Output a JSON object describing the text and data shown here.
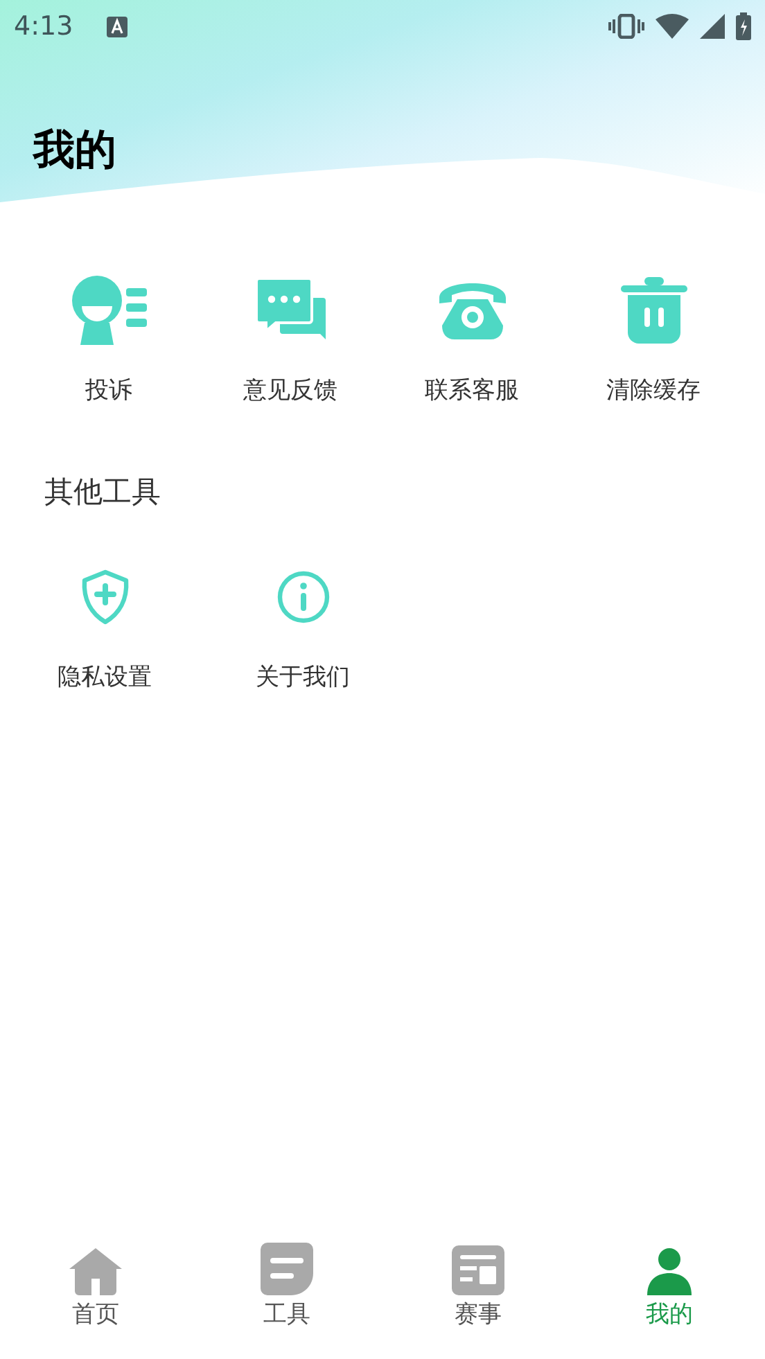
{
  "status_bar": {
    "time": "4:13"
  },
  "header": {
    "title": "我的"
  },
  "services": [
    {
      "kind": "complaint",
      "label": "投诉"
    },
    {
      "kind": "feedback",
      "label": "意见反馈"
    },
    {
      "kind": "phone",
      "label": "联系客服"
    },
    {
      "kind": "trash",
      "label": "清除缓存"
    }
  ],
  "other_tools": {
    "title": "其他工具",
    "items": [
      {
        "kind": "shield",
        "label": "隐私设置"
      },
      {
        "kind": "info",
        "label": "关于我们"
      }
    ]
  },
  "bottom_nav": [
    {
      "kind": "home",
      "label": "首页",
      "selected": false
    },
    {
      "kind": "tools",
      "label": "工具",
      "selected": false
    },
    {
      "kind": "events",
      "label": "赛事",
      "selected": false
    },
    {
      "kind": "me",
      "label": "我的",
      "selected": true
    }
  ]
}
